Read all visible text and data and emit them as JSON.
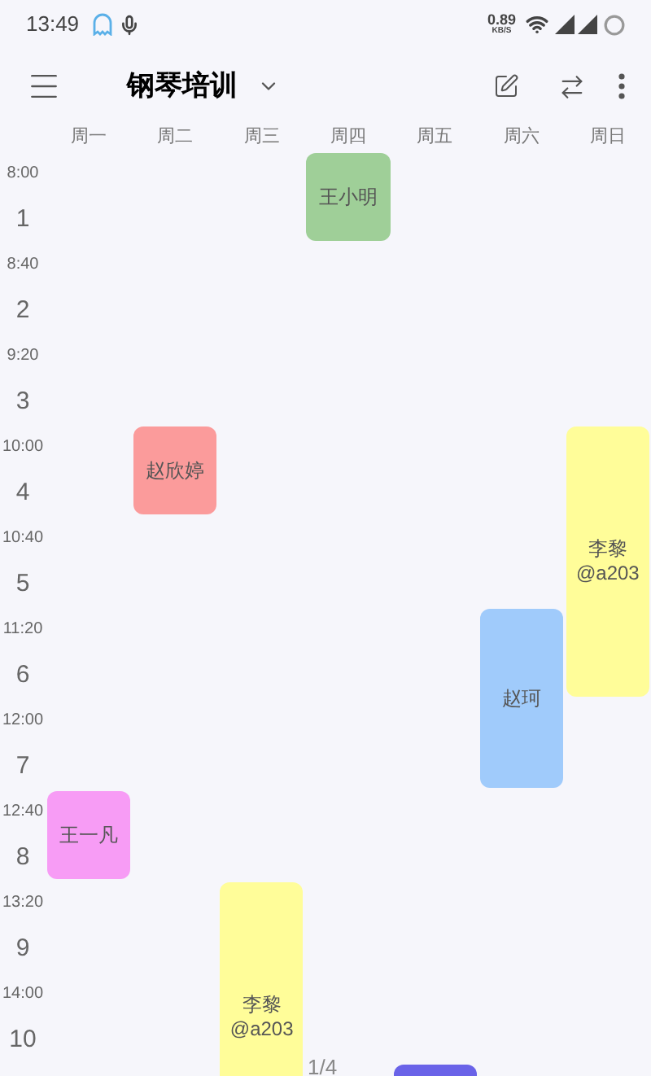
{
  "status_bar": {
    "time": "13:49",
    "speed_value": "0.89",
    "speed_unit": "KB/S"
  },
  "toolbar": {
    "title": "钢琴培训"
  },
  "days": [
    "周一",
    "周二",
    "周三",
    "周四",
    "周五",
    "周六",
    "周日"
  ],
  "periods": [
    {
      "time": "8:00",
      "number": "1"
    },
    {
      "time": "8:40",
      "number": "2"
    },
    {
      "time": "9:20",
      "number": "3"
    },
    {
      "time": "10:00",
      "number": "4"
    },
    {
      "time": "10:40",
      "number": "5"
    },
    {
      "time": "11:20",
      "number": "6"
    },
    {
      "time": "12:00",
      "number": "7"
    },
    {
      "time": "12:40",
      "number": "8"
    },
    {
      "time": "13:20",
      "number": "9"
    },
    {
      "time": "14:00",
      "number": "10"
    }
  ],
  "courses": [
    {
      "color": "#9fcf98",
      "lines": [
        "王小明"
      ]
    },
    {
      "color": "#fb9b9b",
      "lines": [
        "赵欣婷"
      ]
    },
    {
      "color": "#fffd99",
      "lines": [
        "李黎",
        "@a203"
      ]
    },
    {
      "color": "#a0cbfb",
      "lines": [
        "赵珂"
      ]
    },
    {
      "color": "#f79cf5",
      "lines": [
        "王一凡"
      ]
    },
    {
      "color": "#fffd99",
      "lines": [
        "李黎",
        "@a203"
      ]
    },
    {
      "color": "#6a63e8"
    }
  ],
  "page_indicator": "1/4"
}
